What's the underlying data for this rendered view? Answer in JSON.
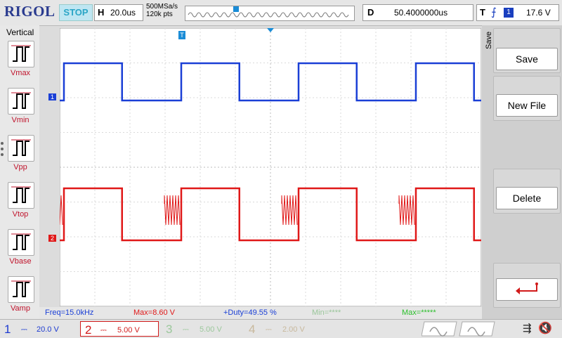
{
  "header": {
    "brand": "RIGOL",
    "run_state": "STOP",
    "horizontal": {
      "key": "H",
      "value": "20.0us"
    },
    "sample_rate": "500MSa/s",
    "memory_depth": "120k pts",
    "delay": {
      "key": "D",
      "value": "50.4000000us"
    },
    "trigger": {
      "key": "T",
      "edge_symbol": "⨍",
      "channel": "1",
      "level": "17.6 V"
    }
  },
  "left_panel": {
    "title": "Vertical",
    "items": [
      {
        "label": "Vmax",
        "icon": "waveform-icon"
      },
      {
        "label": "Vmin",
        "icon": "waveform-icon"
      },
      {
        "label": "Vpp",
        "icon": "waveform-icon"
      },
      {
        "label": "Vtop",
        "icon": "waveform-icon"
      },
      {
        "label": "Vbase",
        "icon": "waveform-icon"
      },
      {
        "label": "Vamp",
        "icon": "waveform-icon"
      }
    ]
  },
  "right_menu": {
    "side_label": "Save",
    "items": [
      {
        "label": "Save"
      },
      {
        "label": "New File"
      },
      {
        "label": "Delete"
      },
      {
        "label": "",
        "icon": "return-arrow-icon"
      }
    ]
  },
  "markers": {
    "ch1": "1",
    "ch2": "2",
    "trigger_pos": "T"
  },
  "measurements": {
    "freq": "Freq=15.0kHz",
    "max": "Max=8.60 V",
    "duty": "+Duty=49.55 %",
    "min": "Min=****",
    "max2": "Max=*****"
  },
  "channels": [
    {
      "num": "1",
      "scale": "20.0 V",
      "color": "#1d3bd1",
      "active": true
    },
    {
      "num": "2",
      "scale": "5.00 V",
      "color": "#d11a1a",
      "active": true
    },
    {
      "num": "3",
      "scale": "5.00 V",
      "color": "#9cc89c",
      "active": false
    },
    {
      "num": "4",
      "scale": "2.00 V",
      "color": "#c8b89c",
      "active": false
    }
  ],
  "colors": {
    "ch1": "#1a3fd6",
    "ch2": "#e01818",
    "grid": "#cfcfcf",
    "accent": "#2aa5c6"
  }
}
